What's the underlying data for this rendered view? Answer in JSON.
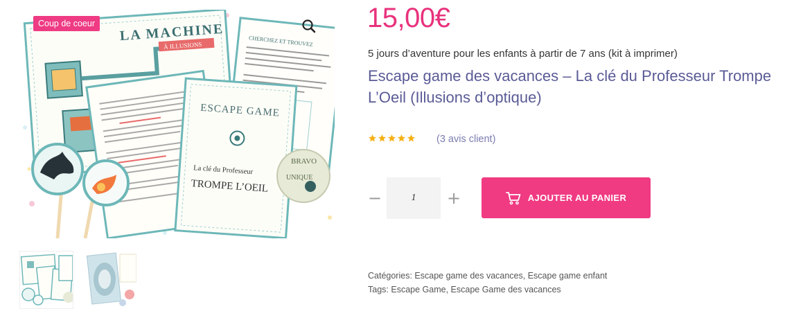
{
  "product": {
    "badge": "Coup de coeur",
    "price": "15,00€",
    "subtitle": "5 jours d’aventure pour les enfants à partir de 7 ans (kit à imprimer)",
    "title": "Escape game des vacances – La clé du Professeur Trompe L’Oeil (Illusions d’optique)",
    "rating": 5,
    "reviews_label": "(3 avis client)"
  },
  "gallery": {
    "zoom_icon": "magnifier-icon",
    "doc1_title": "LA MACHINE",
    "doc1_subtitle": "À ILLUSIONS",
    "doc2_title": "CHERCHEZ ET TROUVEZ",
    "doc3_title": "ESCAPE GAME",
    "doc3_line1": "La clé du Professeur",
    "doc3_line2": "TROMPE L’OEIL",
    "sticker_top": "BRAVO",
    "sticker_mid": "UNIQUE",
    "thumbnails": [
      "thumb-1",
      "thumb-2"
    ]
  },
  "cart": {
    "quantity": "1",
    "minus": "−",
    "plus": "+",
    "add_label": "AJOUTER AU PANIER",
    "cart_icon": "cart-icon"
  },
  "meta": {
    "categories_label": "Catégories:",
    "categories": [
      "Escape game des vacances",
      "Escape game enfant"
    ],
    "tags_label": "Tags:",
    "tags": [
      "Escape Game",
      "Escape Game des vacances"
    ]
  },
  "colors": {
    "accent": "#f03a82",
    "price": "#e8327c",
    "title": "#5a5b96",
    "star": "#f5b014"
  }
}
